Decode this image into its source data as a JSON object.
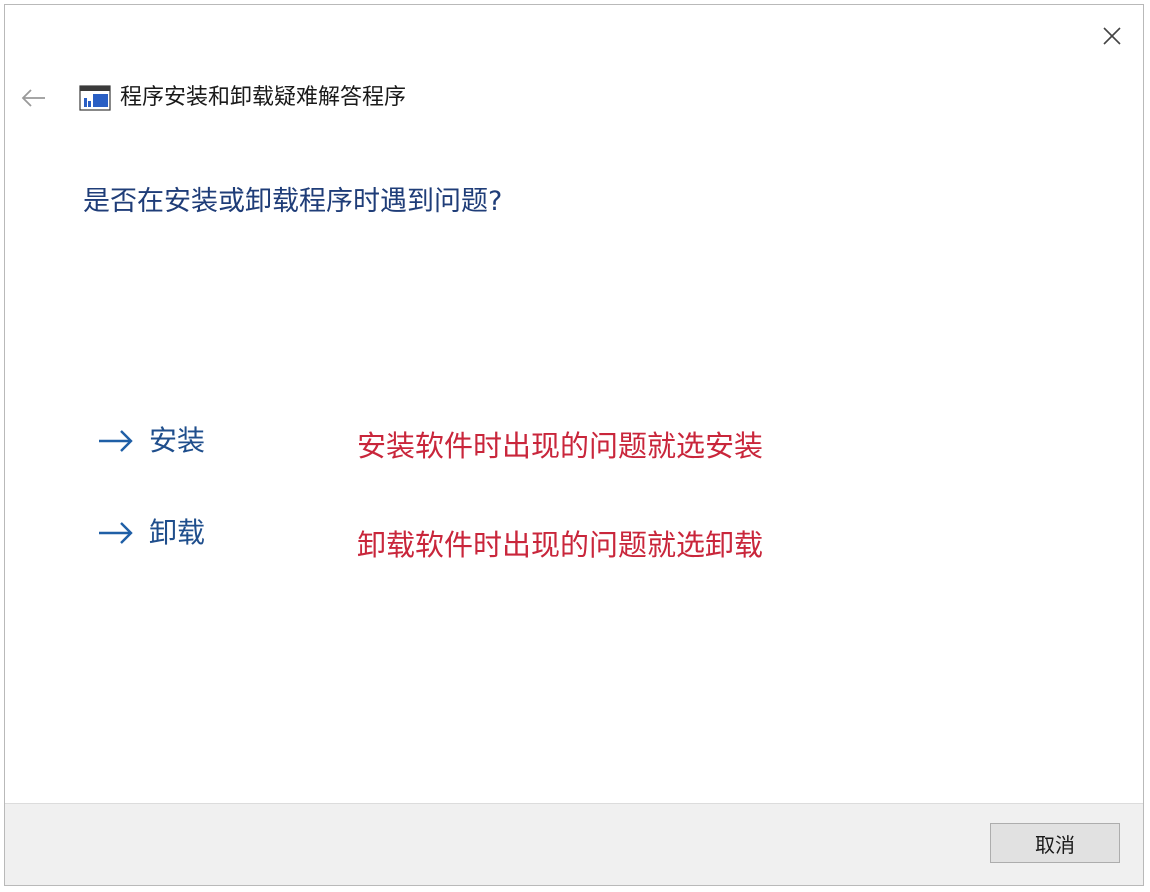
{
  "window": {
    "title": "程序安装和卸载疑难解答程序",
    "close_icon": "close-icon",
    "back_icon": "back-arrow-icon",
    "app_icon": "troubleshooter-icon"
  },
  "main": {
    "question": "是否在安装或卸载程序时遇到问题?",
    "options": [
      {
        "label": "安装",
        "icon": "arrow-right-icon"
      },
      {
        "label": "卸载",
        "icon": "arrow-right-icon"
      }
    ],
    "annotations": [
      "安装软件时出现的问题就选安装",
      "卸载软件时出现的问题就选卸载"
    ]
  },
  "footer": {
    "cancel_label": "取消"
  },
  "colors": {
    "question": "#1f3d78",
    "option": "#1f4e8c",
    "annotation": "#c9263b",
    "footer_bg": "#f0f0f0"
  }
}
